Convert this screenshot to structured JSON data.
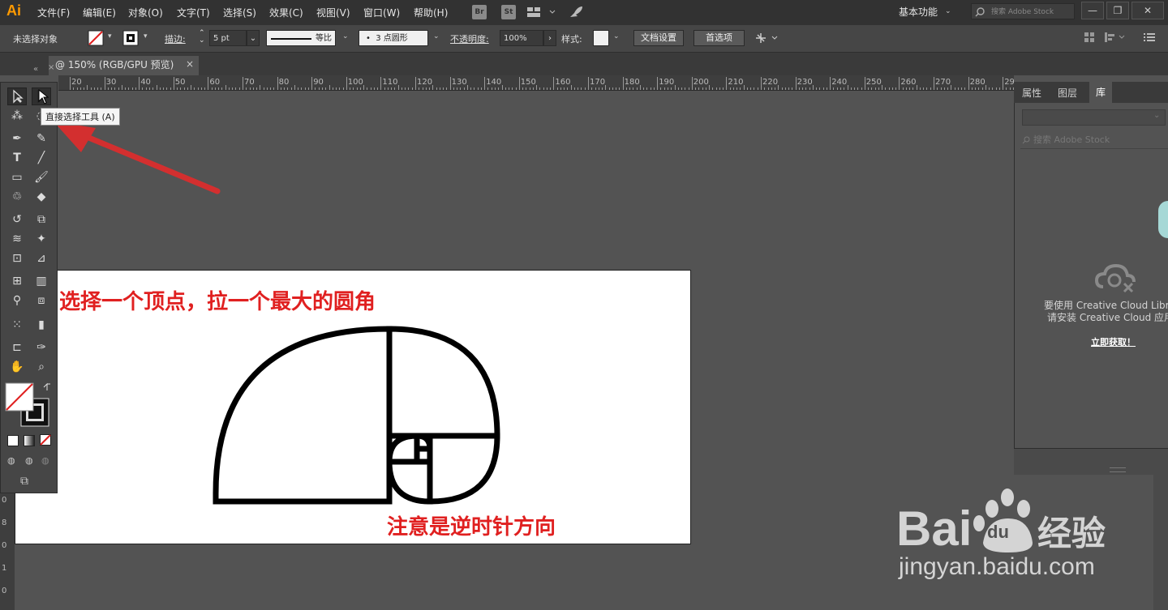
{
  "app": {
    "logo": "Ai"
  },
  "menu": [
    "文件(F)",
    "编辑(E)",
    "对象(O)",
    "文字(T)",
    "选择(S)",
    "效果(C)",
    "视图(V)",
    "窗口(W)",
    "帮助(H)"
  ],
  "menu_icons": {
    "br": "Br",
    "st": "St"
  },
  "workspace": {
    "label": "基本功能",
    "search_placeholder": "搜索 Adobe Stock"
  },
  "window_controls": {
    "minimize": "—",
    "restore": "❐",
    "close": "✕"
  },
  "control": {
    "selection": "未选择对象",
    "stroke_label": "描边:",
    "stroke_value": "5 pt",
    "stroke_profile": "等比",
    "brush": "3 点圆形",
    "opacity_label": "不透明度:",
    "opacity_value": "100%",
    "style_label": "样式:",
    "doc_setup": "文档设置",
    "preferences": "首选项"
  },
  "document_tab": {
    "title": "@ 150% (RGB/GPU 预览)",
    "close": "×"
  },
  "ruler": {
    "top": [
      "20",
      "30",
      "40",
      "50",
      "60",
      "70",
      "80",
      "90",
      "100",
      "110",
      "120",
      "130",
      "140",
      "150",
      "160",
      "170",
      "180",
      "190",
      "200",
      "210",
      "220",
      "230",
      "240",
      "250",
      "260",
      "270",
      "280",
      "29"
    ],
    "left": [
      "0",
      "8",
      "0",
      "1",
      "0"
    ]
  },
  "tooltip": "直接选择工具 (A)",
  "artboard": {
    "note_top": "选择一个顶点，拉一个最大的圆角",
    "note_bottom": "注意是逆时针方向"
  },
  "right_panel": {
    "tabs": [
      "属性",
      "图层",
      "库"
    ],
    "search_placeholder": "搜索 Adobe Stock",
    "message_line1": "要使用 Creative Cloud Librari",
    "message_line2": "请安装 Creative Cloud 应用程",
    "link": "立即获取！"
  },
  "watermark": {
    "brand": "Bai du 经验",
    "url": "jingyan.baidu.com"
  },
  "colors": {
    "menubar": "#323232",
    "controlbar": "#464646",
    "canvas": "#535353",
    "note_red": "#e02020",
    "arrow_red": "#d32f2f"
  }
}
